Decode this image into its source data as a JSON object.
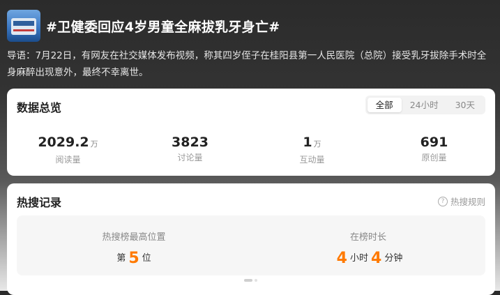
{
  "topic": {
    "title": "#卫健委回应4岁男童全麻拔乳牙身亡#",
    "intro": "导语：7月22日，有网友在社交媒体发布视频，称其四岁侄子在桂阳县第一人民医院（总院）接受乳牙拔除手术时全身麻醉出现意外，最终不幸离世。"
  },
  "overview": {
    "title": "数据总览",
    "tabs": [
      "全部",
      "24小时",
      "30天"
    ],
    "active_tab": "全部",
    "stats": [
      {
        "value": "2029.2",
        "unit": "万",
        "label": "阅读量"
      },
      {
        "value": "3823",
        "unit": "",
        "label": "讨论量"
      },
      {
        "value": "1",
        "unit": "万",
        "label": "互动量"
      },
      {
        "value": "691",
        "unit": "",
        "label": "原创量"
      }
    ]
  },
  "hot": {
    "title": "热搜记录",
    "rule_link": "热搜规则",
    "peak_caption": "热搜榜最高位置",
    "peak_prefix": "第",
    "peak_value": "5",
    "peak_suffix": "位",
    "duration_caption": "在榜时长",
    "hours": "4",
    "hours_unit": "小时",
    "minutes": "4",
    "minutes_unit": "分钟"
  },
  "icons": {
    "thumbnail": "topic-thumbnail",
    "help": "question-circle-icon"
  },
  "colors": {
    "accent": "#ff7a00"
  }
}
